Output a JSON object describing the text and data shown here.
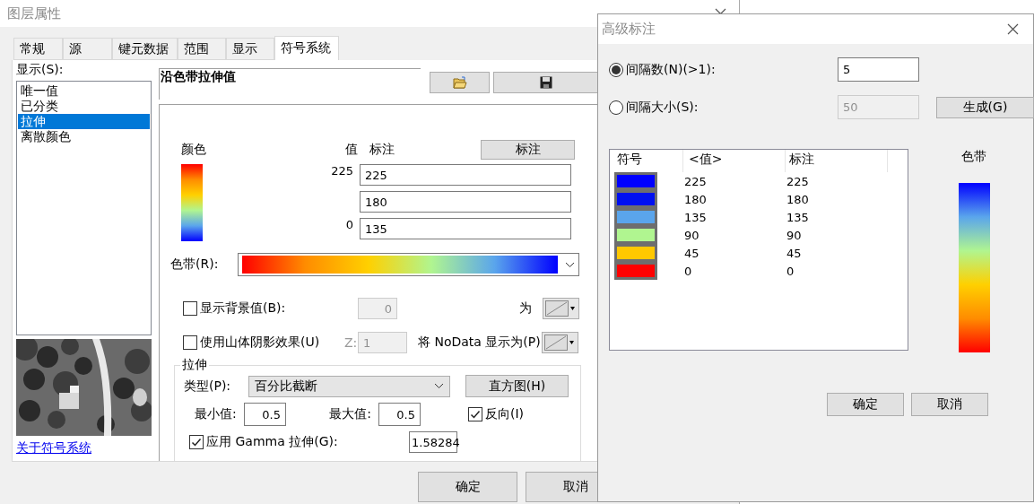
{
  "main_window": {
    "title": "图层属性",
    "tabs": [
      {
        "label": "常规",
        "selected": false
      },
      {
        "label": "源",
        "selected": false
      },
      {
        "label": "键元数据",
        "selected": false
      },
      {
        "label": "范围",
        "selected": false
      },
      {
        "label": "显示",
        "selected": false
      },
      {
        "label": "符号系统",
        "selected": true
      }
    ],
    "show_label": "显示(S):",
    "renderers": [
      {
        "label": "唯一值",
        "selected": false
      },
      {
        "label": "已分类",
        "selected": false
      },
      {
        "label": "拉伸",
        "selected": true
      },
      {
        "label": "离散颜色",
        "selected": false
      }
    ],
    "preview": {
      "kind": "picture"
    },
    "about_link": "关于符号系统",
    "renderer_title": "沿色带拉伸值",
    "color_header": "颜色",
    "value_header": "值",
    "label_header": "标注",
    "label_button": "标注",
    "ramp_rows": [
      {
        "value": "225",
        "label": "225"
      },
      {
        "label": "180"
      },
      {
        "value": "0",
        "label": "135"
      }
    ],
    "color_ramp_label": "色带(R):",
    "background": {
      "label": "显示背景值(B):",
      "checked": false,
      "value": "0",
      "disabled": true,
      "as_label": "为"
    },
    "hillshade": {
      "label": "使用山体阴影效果(U)",
      "checked": false,
      "z_label": "Z:",
      "z_value": "1",
      "disabled": true,
      "nodata_label": "将 NoData 显示为(P)"
    },
    "stretch": {
      "legend": "拉伸",
      "type_label": "类型(P):",
      "type_value": "百分比截断",
      "histogram_button": "直方图(H)",
      "min_label": "最小值:",
      "min_value": "0.5",
      "max_label": "最大值:",
      "max_value": "0.5",
      "invert": {
        "label": "反向(I)",
        "checked": true
      },
      "gamma": {
        "label": "应用 Gamma 拉伸(G):",
        "checked": true,
        "value": "1.58284"
      }
    },
    "buttons": [
      "确定",
      "取消"
    ]
  },
  "dialog": {
    "title": "高级标注",
    "options": [
      {
        "label": "间隔数(N)(>1):",
        "selected": true,
        "value": "5",
        "disabled": false
      },
      {
        "label": "间隔大小(S):",
        "selected": false,
        "value": "50",
        "disabled": true
      }
    ],
    "generate_button": "生成(G)",
    "table": {
      "columns": [
        "符号",
        "<值>",
        "标注"
      ],
      "rows": [
        {
          "color": "#0000ff",
          "value": "225",
          "label": "225"
        },
        {
          "color": "#0010f0",
          "value": "180",
          "label": "180"
        },
        {
          "color": "#5aa5ec",
          "value": "135",
          "label": "135"
        },
        {
          "color": "#b0f590",
          "value": "90",
          "label": "90"
        },
        {
          "color": "#ffc800",
          "value": "45",
          "label": "45"
        },
        {
          "color": "#ff0000",
          "value": "0",
          "label": "0"
        }
      ]
    },
    "ramp_label": "色带",
    "buttons": [
      "确定",
      "取消"
    ]
  }
}
